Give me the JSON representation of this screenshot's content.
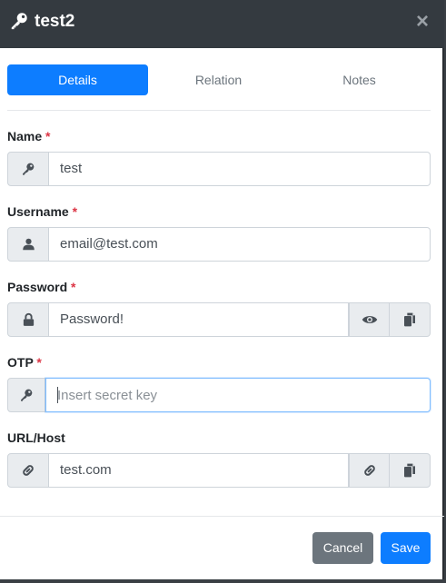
{
  "modal": {
    "title": "test2",
    "close_symbol": "×",
    "header_icon": "key-icon"
  },
  "tabs": [
    {
      "label": "Details",
      "active": true
    },
    {
      "label": "Relation",
      "active": false
    },
    {
      "label": "Notes",
      "active": false
    }
  ],
  "fields": {
    "name": {
      "label": "Name",
      "required_mark": "*",
      "value": "test",
      "icon": "key-icon"
    },
    "username": {
      "label": "Username",
      "required_mark": "*",
      "value": "email@test.com",
      "icon": "user-icon"
    },
    "password": {
      "label": "Password",
      "required_mark": "*",
      "value": "Password!",
      "icon": "lock-icon",
      "actions": [
        "eye-icon",
        "copy-icon"
      ]
    },
    "otp": {
      "label": "OTP",
      "required_mark": "*",
      "value": "",
      "placeholder": "Insert secret key",
      "icon": "key-icon"
    },
    "url": {
      "label": "URL/Host",
      "value": "test.com",
      "icon": "link-icon",
      "actions": [
        "link-icon",
        "copy-icon"
      ]
    }
  },
  "footer": {
    "cancel_label": "Cancel",
    "save_label": "Save"
  },
  "colors": {
    "header_bg": "#343a40",
    "primary": "#0d7dff",
    "secondary": "#6c757d",
    "required": "#dc3545"
  }
}
